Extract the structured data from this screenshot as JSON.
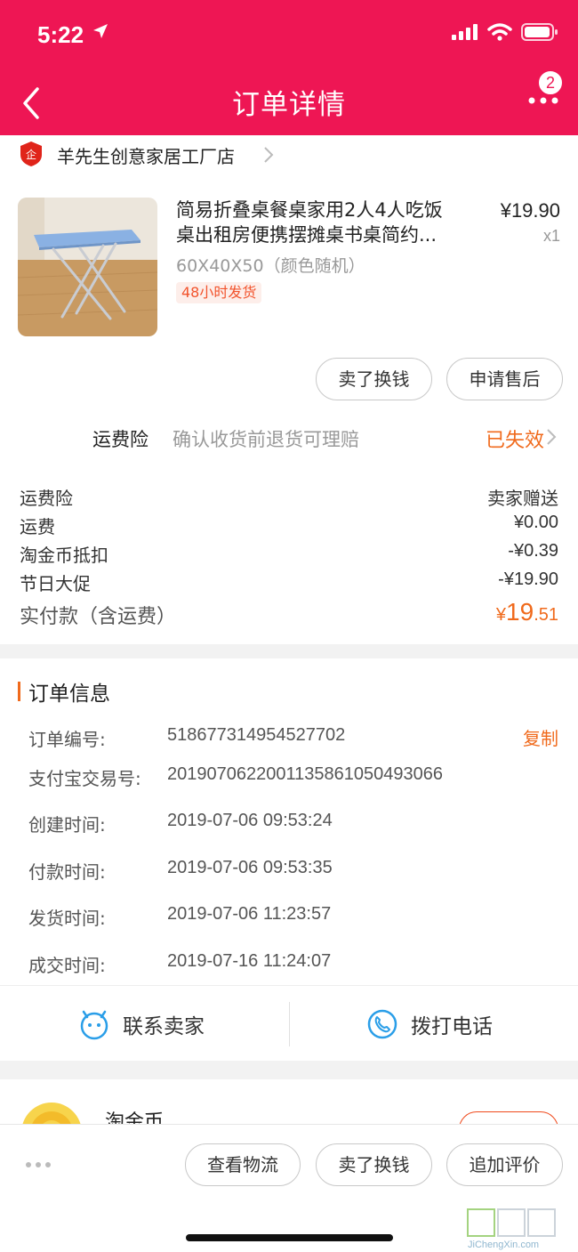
{
  "status_bar": {
    "time": "5:22"
  },
  "nav": {
    "title": "订单详情",
    "badge": "2"
  },
  "shop": {
    "name": "羊先生创意家居工厂店"
  },
  "product": {
    "title_line1": "简易折叠桌餐桌家用2人4人吃饭",
    "title_line2": "桌出租房便携摆摊桌书桌简约...",
    "sku": "60X40X50（颜色随机）",
    "tag": "48小时发货",
    "price": "¥19.90",
    "qty": "x1"
  },
  "product_actions": {
    "sell_label": "卖了换钱",
    "after_sale_label": "申请售后"
  },
  "insurance": {
    "label": "运费险",
    "desc": "确认收货前退货可理赔",
    "status": "已失效"
  },
  "fees": [
    {
      "label": "运费险",
      "value": "卖家赠送"
    },
    {
      "label": "运费",
      "value": "¥0.00"
    },
    {
      "label": "淘金币抵扣",
      "value": "-¥0.39"
    },
    {
      "label": "节日大促",
      "value": "-¥19.90"
    }
  ],
  "total": {
    "label": "实付款（含运费）",
    "currency": "¥",
    "integer": "19",
    "decimal": ".51"
  },
  "order_info": {
    "title": "订单信息",
    "copy_label": "复制",
    "rows": [
      {
        "label": "订单编号:",
        "value": "518677314954527702"
      },
      {
        "label": "支付宝交易号:",
        "value": "2019070622001135861050493066"
      },
      {
        "label": "创建时间:",
        "value": "2019-07-06 09:53:24"
      },
      {
        "label": "付款时间:",
        "value": "2019-07-06 09:53:35"
      },
      {
        "label": "发货时间:",
        "value": "2019-07-06 11:23:57"
      },
      {
        "label": "成交时间:",
        "value": "2019-07-16 11:24:07"
      }
    ]
  },
  "contact": {
    "seller_label": "联系卖家",
    "phone_label": "拨打电话"
  },
  "coin_card": {
    "title": "淘金币"
  },
  "bottom_bar": {
    "logistics_label": "查看物流",
    "sell_label": "卖了换钱",
    "review_label": "追加评价"
  },
  "colors": {
    "brand": "#ee1654",
    "accent_orange": "#f06a1c",
    "contact_icon": "#2a9ee8"
  },
  "icons": [
    "location-arrow-icon",
    "cellular-signal-icon",
    "wifi-icon",
    "battery-icon",
    "back-icon",
    "more-icon",
    "enterprise-shop-icon",
    "chevron-right-icon",
    "chat-bubble-icon",
    "phone-icon",
    "gold-coin-icon",
    "more-dots-icon"
  ],
  "watermark": {
    "text": "JiChengXin.com"
  }
}
